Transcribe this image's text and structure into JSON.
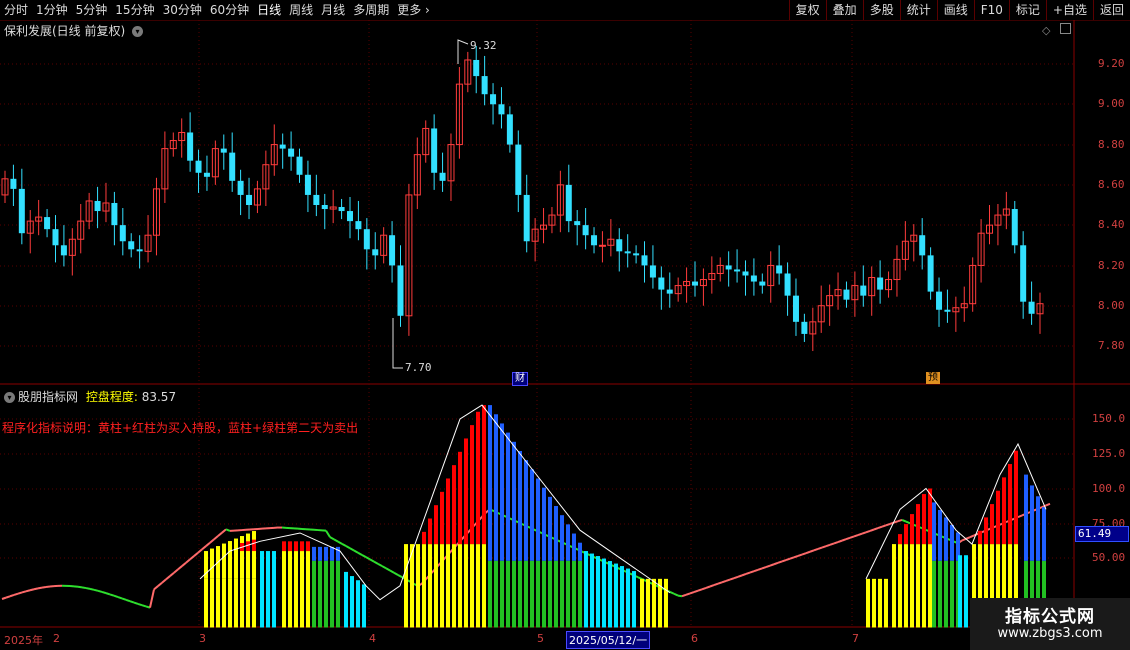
{
  "toolbar": {
    "periods": [
      "分时",
      "1分钟",
      "5分钟",
      "15分钟",
      "30分钟",
      "60分钟",
      "日线",
      "周线",
      "月线",
      "多周期",
      "更多"
    ],
    "active_period": "日线",
    "tools": [
      "复权",
      "叠加",
      "多股",
      "统计",
      "画线",
      "F10",
      "标记",
      "+自选",
      "返回"
    ]
  },
  "main_panel": {
    "title": "保利发展(日线 前复权)",
    "high_label": "9.32",
    "low_label": "7.70",
    "price_axis": [
      "9.20",
      "9.00",
      "8.80",
      "8.60",
      "8.40",
      "8.20",
      "8.00",
      "7.80"
    ],
    "badges": {
      "fin": "财",
      "pre": "预"
    }
  },
  "indicator_panel": {
    "name": "股朋指标网",
    "metric_label": "控盘程度:",
    "metric_value": "83.57",
    "description": "程序化指标说明：黄柱+红柱为买入持股，蓝柱+绿柱第二天为卖出",
    "axis": [
      "150.0",
      "125.0",
      "100.0",
      "75.00",
      "50.00"
    ],
    "current_value": "61.49",
    "colors": {
      "yellow": "#ffff00",
      "red": "#ff0000",
      "blue": "#1f5fff",
      "green": "#22c022",
      "cyan": "#00e5ff"
    }
  },
  "date_axis": {
    "labels": [
      "2025年",
      "2",
      "3",
      "4",
      "5",
      "6",
      "7"
    ],
    "cursor_date": "2025/05/12/一"
  },
  "watermark": {
    "title": "指标公式网",
    "url": "www.zbgs3.com"
  }
}
